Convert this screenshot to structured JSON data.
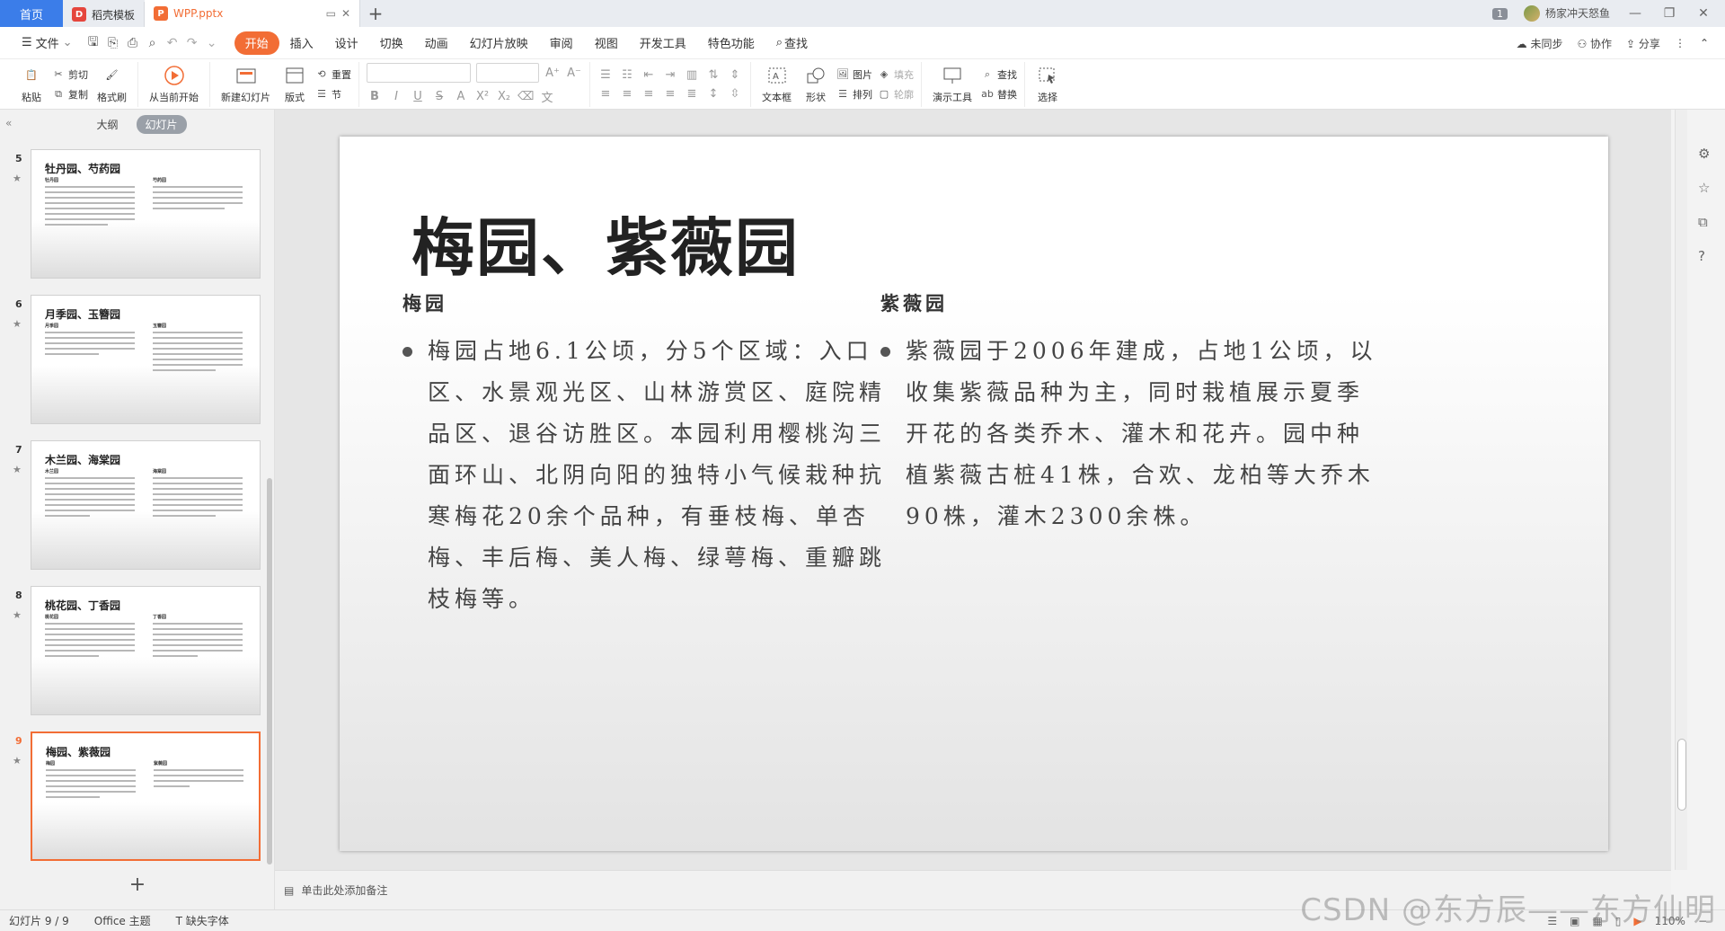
{
  "tabs": {
    "home": "首页",
    "template": "稻壳模板",
    "file": "WPP.pptx",
    "new_tab": "+"
  },
  "titlebar": {
    "window_count": "1",
    "user_name": "杨家冲天怒鱼"
  },
  "menubar": {
    "file": "文件",
    "items": [
      "开始",
      "插入",
      "设计",
      "切换",
      "动画",
      "幻灯片放映",
      "审阅",
      "视图",
      "开发工具",
      "特色功能"
    ],
    "search": "查找",
    "right": {
      "sync": "未同步",
      "collab": "协作",
      "share": "分享"
    }
  },
  "ribbon": {
    "paste": "粘贴",
    "cut": "剪切",
    "copy": "复制",
    "format_painter": "格式刷",
    "from_current": "从当前开始",
    "new_slide": "新建幻灯片",
    "layout": "版式",
    "reset": "重置",
    "section": "节",
    "textbox": "文本框",
    "shape": "形状",
    "picture": "图片",
    "arrange": "排列",
    "fill": "填充",
    "outline": "轮廓",
    "present_tools": "演示工具",
    "find": "查找",
    "replace": "替换",
    "select": "选择"
  },
  "left_panel": {
    "tab_outline": "大纲",
    "tab_slides": "幻灯片",
    "thumbnails": [
      {
        "num": "5",
        "title": "牡丹园、芍药园",
        "sub_left": "牡丹园",
        "sub_right": "芍药园"
      },
      {
        "num": "6",
        "title": "月季园、玉簪园",
        "sub_left": "月季园",
        "sub_right": "玉簪园"
      },
      {
        "num": "7",
        "title": "木兰园、海棠园",
        "sub_left": "木兰园",
        "sub_right": "海棠园"
      },
      {
        "num": "8",
        "title": "桃花园、丁香园",
        "sub_left": "桃花园",
        "sub_right": "丁香园"
      },
      {
        "num": "9",
        "title": "梅园、紫薇园",
        "sub_left": "梅园",
        "sub_right": "紫薇园"
      }
    ]
  },
  "slide": {
    "title": "梅园、紫薇园",
    "left": {
      "subtitle": "梅园",
      "body": "梅园占地6.1公顷，分5个区域：入口区、水景观光区、山林游赏区、庭院精品区、退谷访胜区。本园利用樱桃沟三面环山、北阴向阳的独特小气候栽种抗寒梅花20余个品种，有垂枝梅、单杏梅、丰后梅、美人梅、绿萼梅、重瓣跳枝梅等。"
    },
    "right": {
      "subtitle": "紫薇园",
      "body": "紫薇园于2006年建成，占地1公顷，以收集紫薇品种为主，同时栽植展示夏季开花的各类乔木、灌木和花卉。园中种植紫薇古桩41株，合欢、龙柏等大乔木90株，灌木2300余株。"
    }
  },
  "notes": {
    "placeholder": "单击此处添加备注"
  },
  "statusbar": {
    "slide_count": "幻灯片 9 / 9",
    "theme": "Office 主题",
    "missing_font": "缺失字体",
    "zoom": "110%"
  },
  "watermark": "CSDN @东方辰——东方仙明",
  "colors": {
    "accent": "#f26d35",
    "home_tab": "#3b7de9"
  }
}
